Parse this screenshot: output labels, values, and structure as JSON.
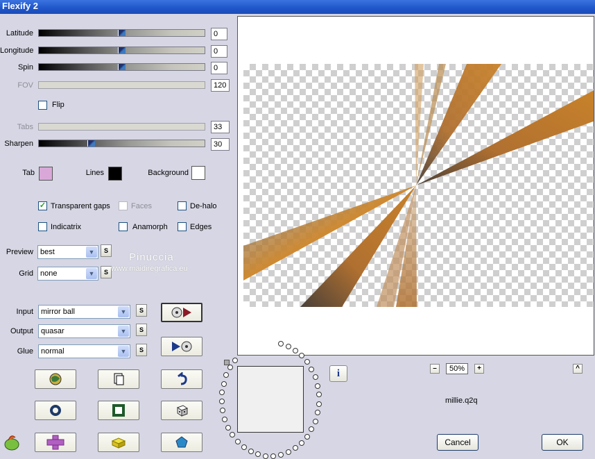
{
  "window": {
    "title": "Flexify 2"
  },
  "sliders": {
    "latitude": {
      "label": "Latitude",
      "value": "0",
      "level": 0.5
    },
    "longitude": {
      "label": "Longitude",
      "value": "0",
      "level": 0.5
    },
    "spin": {
      "label": "Spin",
      "value": "0",
      "level": 0.5
    },
    "fov": {
      "label": "FOV",
      "value": "120"
    },
    "tabs": {
      "label": "Tabs",
      "value": "33"
    },
    "sharpen": {
      "label": "Sharpen",
      "value": "30",
      "level": 0.31
    }
  },
  "flip": {
    "label": "Flip",
    "checked": false
  },
  "colors": {
    "tab": {
      "label": "Tab",
      "color": "#d9a8d8"
    },
    "lines": {
      "label": "Lines",
      "color": "#000000"
    },
    "background": {
      "label": "Background",
      "color": "#ffffff"
    }
  },
  "options": {
    "transparent_gaps": {
      "label": "Transparent gaps",
      "checked": true
    },
    "faces": {
      "label": "Faces",
      "checked": false
    },
    "de_halo": {
      "label": "De-halo",
      "checked": false
    },
    "indicatrix": {
      "label": "Indicatrix",
      "checked": false
    },
    "anamorph": {
      "label": "Anamorph",
      "checked": false
    },
    "edges": {
      "label": "Edges",
      "checked": false
    }
  },
  "preview_select": {
    "label": "Preview",
    "value": "best"
  },
  "grid_select": {
    "label": "Grid",
    "value": "none"
  },
  "input_select": {
    "label": "Input",
    "value": "mirror ball"
  },
  "output_select": {
    "label": "Output",
    "value": "quasar"
  },
  "glue_select": {
    "label": "Glue",
    "value": "normal"
  },
  "s_button_label": "S",
  "watermark": {
    "line1": "Pinuccia",
    "line2": "www.maidiregrafica.eu"
  },
  "zoom": {
    "minus": "–",
    "value": "50%",
    "plus": "+"
  },
  "info_icon_glyph": "i",
  "corner_button_glyph": "^",
  "filename": "millie.q2q",
  "buttons": {
    "cancel": "Cancel",
    "ok": "OK"
  },
  "accent_colors": {
    "orange": "#c8822a",
    "dark_stripe": "#5a4a38",
    "title_blue": "#2158d0"
  }
}
